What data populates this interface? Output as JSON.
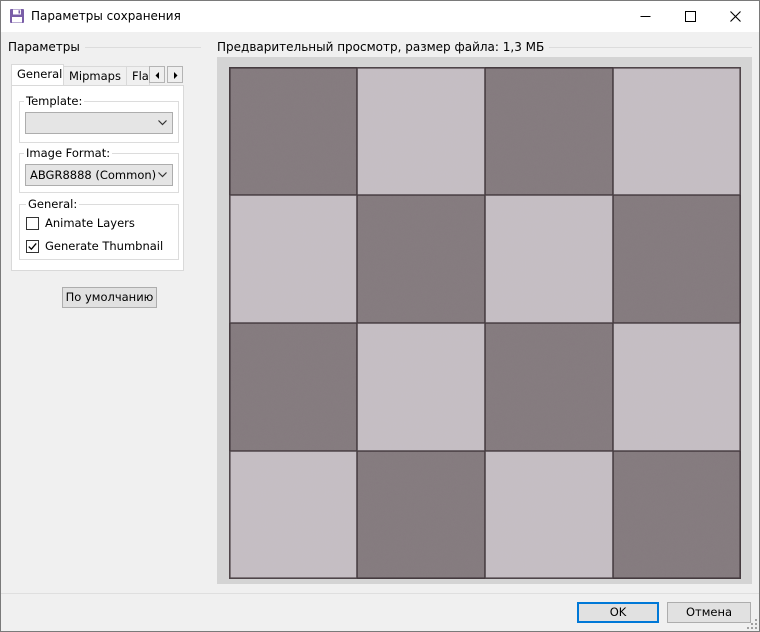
{
  "window": {
    "title": "Параметры сохранения",
    "icon": "floppy-disk-icon",
    "controls": [
      "minimize-icon",
      "maximize-icon",
      "close-icon"
    ]
  },
  "left_panel": {
    "header": "Параметры",
    "tabs": [
      {
        "label": "General",
        "active": true
      },
      {
        "label": "Mipmaps",
        "active": false
      },
      {
        "label": "Fla",
        "active": false
      }
    ],
    "tab_scroll_icons": [
      "arrow-left-icon",
      "arrow-right-icon"
    ],
    "template": {
      "legend": "Template:",
      "value": ""
    },
    "image_format": {
      "legend": "Image Format:",
      "value": "ABGR8888 (Common)"
    },
    "general": {
      "legend": "General:",
      "options": [
        {
          "label": "Animate Layers",
          "checked": false
        },
        {
          "label": "Generate Thumbnail",
          "checked": true
        }
      ]
    },
    "default_button": "По умолчанию"
  },
  "preview": {
    "header": "Предварительный просмотр, размер файла: 1,3 МБ",
    "image": "stone-tile-texture"
  },
  "footer": {
    "ok": "OK",
    "cancel": "Отмена"
  },
  "colors": {
    "accent": "#0078d7",
    "tile_dark": "#857b7f",
    "tile_light": "#c5bec3"
  }
}
